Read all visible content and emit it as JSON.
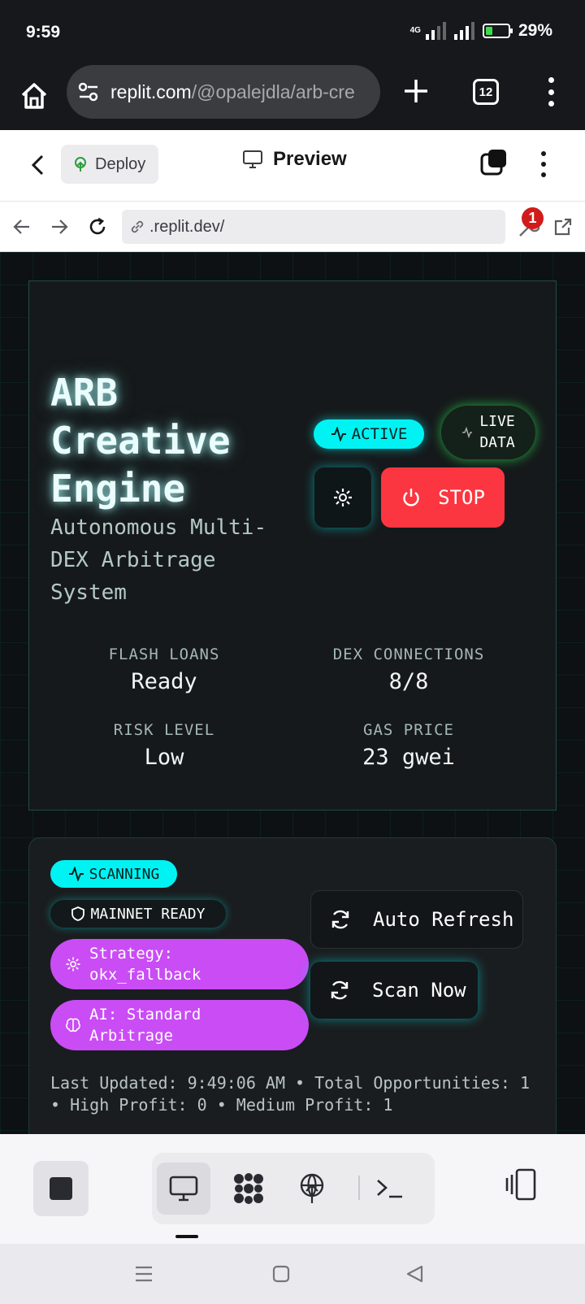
{
  "status_bar": {
    "time": "9:59",
    "network": "4G",
    "battery": "29%"
  },
  "browser": {
    "url_domain": "replit.com",
    "url_path": "/@opalejdla/arb-cre",
    "tab_count": "12"
  },
  "replit_toolbar": {
    "deploy_label": "Deploy",
    "preview_label": "Preview"
  },
  "preview_address": {
    "url": ".replit.dev/",
    "notification_count": "1"
  },
  "hero": {
    "title_line1": "ARB",
    "title_line2": "Creative",
    "title_line3": "Engine",
    "subtitle": "Autonomous Multi-DEX Arbitrage System",
    "active_label": "ACTIVE",
    "live_line1": "LIVE",
    "live_line2": "DATA",
    "stop_label": "STOP",
    "stats": [
      {
        "label": "FLASH LOANS",
        "value": "Ready"
      },
      {
        "label": "DEX CONNECTIONS",
        "value": "8/8"
      },
      {
        "label": "RISK LEVEL",
        "value": "Low"
      },
      {
        "label": "GAS PRICE",
        "value": "23 gwei"
      }
    ]
  },
  "scanner": {
    "scanning_label": "SCANNING",
    "mainnet_label": "MAINNET READY",
    "strategy_label": "Strategy: okx_fallback",
    "ai_label": "AI: Standard Arbitrage",
    "auto_refresh_label": "Auto Refresh",
    "scan_now_label": "Scan Now",
    "footer": "Last Updated: 9:49:06 AM • Total Opportunities: 1 • High Profit: 0 • Medium Profit: 1"
  },
  "colors": {
    "accent_cyan": "#00f3f3",
    "stop_red": "#fb3640",
    "purple": "#c94cf5",
    "live_green": "#28dc50"
  },
  "icons": [
    "home-icon",
    "tune-icon",
    "plus-icon",
    "tabs-icon",
    "menu-icon",
    "back-icon",
    "deploy-icon",
    "monitor-icon",
    "windows-icon",
    "arrow-left-icon",
    "arrow-right-icon",
    "reload-icon",
    "link-icon",
    "wrench-icon",
    "external-link-icon",
    "pulse-icon",
    "gear-icon",
    "power-icon",
    "shield-icon",
    "brain-icon",
    "refresh-icon",
    "stop-icon",
    "agent-icon",
    "deployments-icon",
    "shell-icon",
    "panels-icon"
  ]
}
